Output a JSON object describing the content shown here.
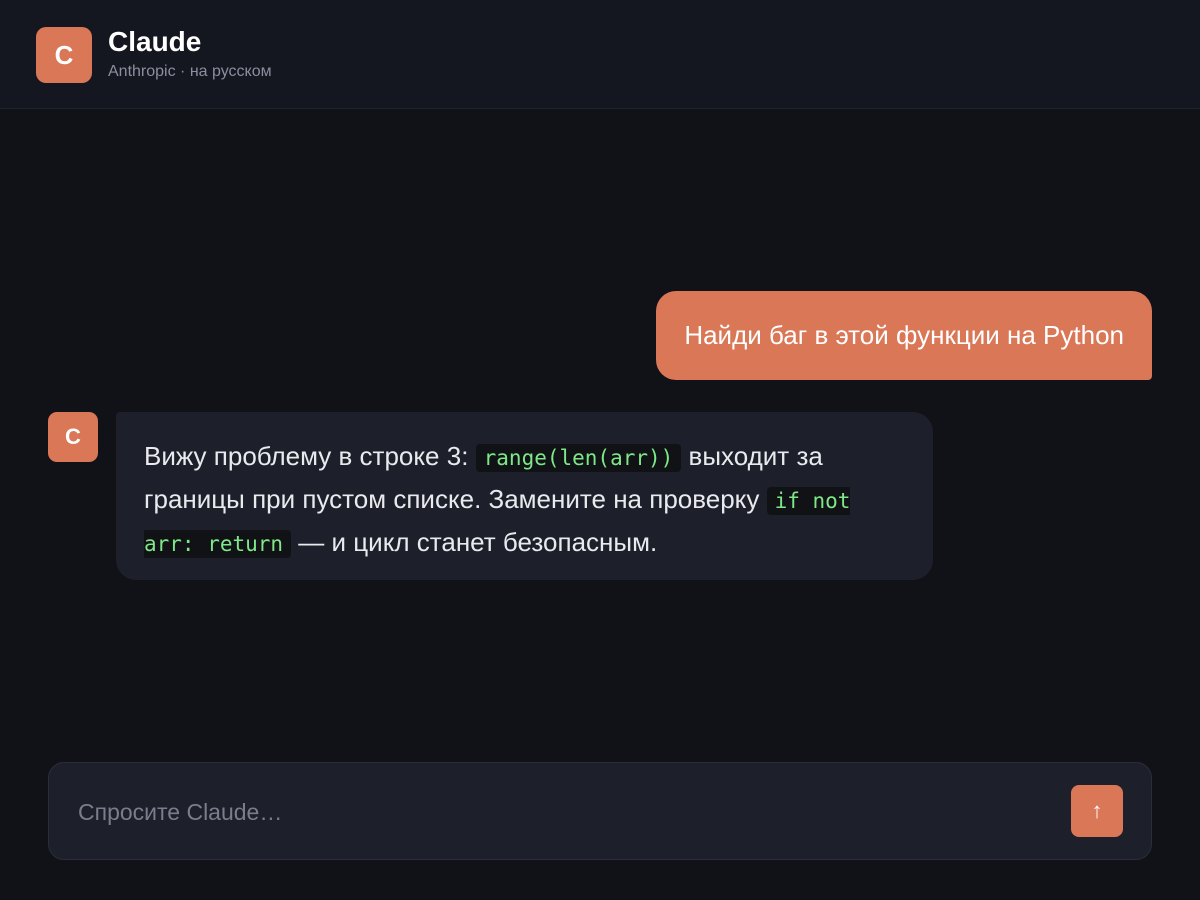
{
  "header": {
    "logo_letter": "C",
    "title": "Claude",
    "subtitle": "Anthropic · на русском"
  },
  "messages": {
    "user": {
      "text": "Найди баг в этой функции на Python"
    },
    "assistant": {
      "avatar_letter": "C",
      "text_part1": "Вижу проблему в строке 3: ",
      "code1": "range(len(arr))",
      "text_part2": " выходит за границы при пустом списке. Замените на проверку ",
      "code2": "if not arr: return",
      "text_part3": " — и цикл станет безопасным."
    }
  },
  "composer": {
    "placeholder": "Спросите Claude…",
    "send_icon": "arrow-up-icon",
    "send_glyph": "↑"
  },
  "colors": {
    "accent": "#d97757",
    "background": "#111218",
    "surface": "#1d1f2a",
    "code_text": "#7ee787"
  }
}
